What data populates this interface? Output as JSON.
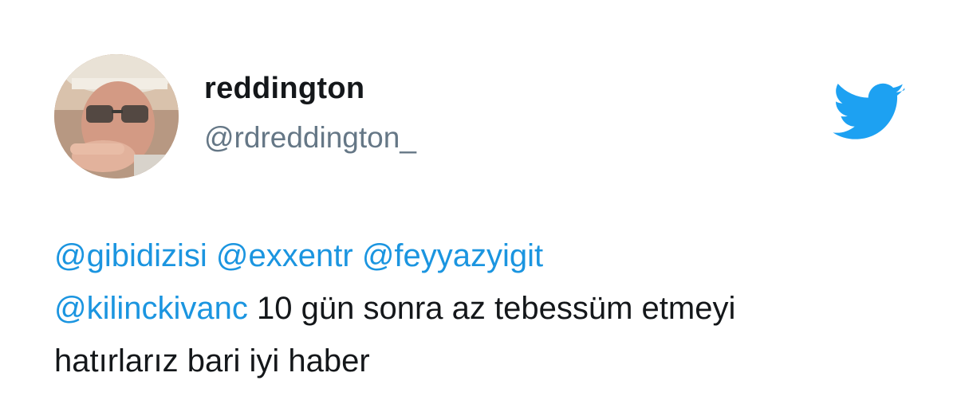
{
  "user": {
    "display_name": "reddington",
    "handle": "@rdreddington_"
  },
  "tweet": {
    "mentions": [
      "@gibidizisi",
      "@exxentr",
      "@feyyazyigit",
      "@kilinckivanc"
    ],
    "text_line2_rest": "10 gün sonra az tebessüm etmeyi",
    "text_line3": "hatırlarız bari iyi haber"
  },
  "icons": {
    "brand": "twitter-bird-icon"
  },
  "colors": {
    "brand_blue": "#1da1f2",
    "mention_blue": "#1b95e0",
    "name_text": "#14171a",
    "handle_text": "#657786"
  }
}
